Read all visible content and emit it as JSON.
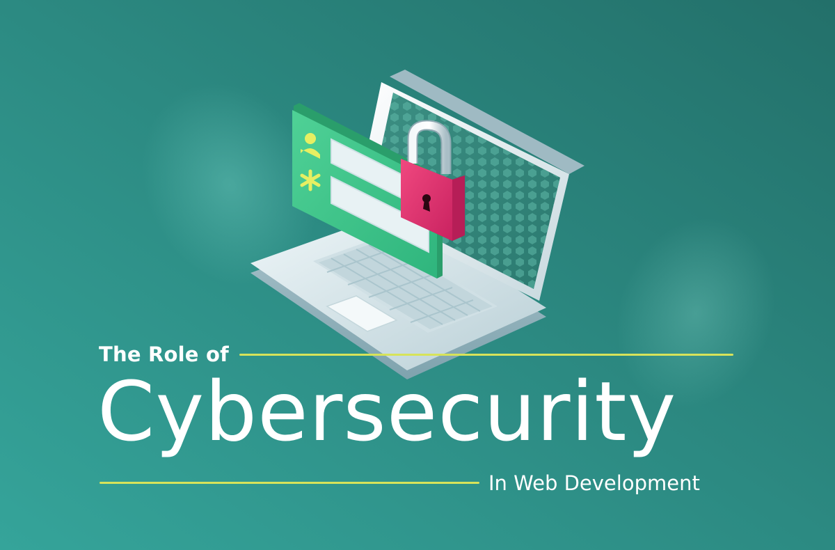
{
  "colors": {
    "background_start": "#2f9f96",
    "background_end": "#236f69",
    "accent_rule": "#d7e35a",
    "lock_body": "#e0356f",
    "form_panel": "#3fca8e",
    "text": "#ffffff"
  },
  "title": {
    "kicker": "The Role of",
    "headline": "Cybersecurity",
    "subline": "In Web Development"
  },
  "icons": {
    "user": "user-icon",
    "password": "asterisk-icon",
    "lock": "padlock-icon",
    "keyhole": "keyhole-icon"
  }
}
